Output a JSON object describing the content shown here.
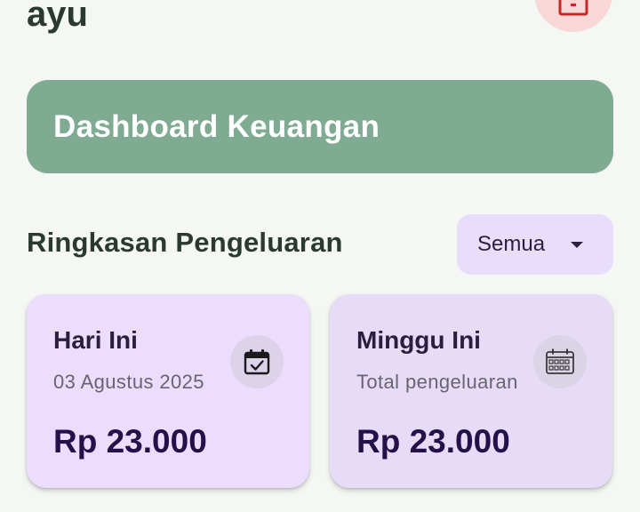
{
  "header": {
    "greeting": "ayu"
  },
  "banner": {
    "title": "Dashboard Keuangan"
  },
  "summary": {
    "title": "Ringkasan Pengeluaran",
    "filter": {
      "selected": "Semua"
    },
    "cards": [
      {
        "title": "Hari Ini",
        "subtitle": "03 Agustus 2025",
        "amount": "Rp 23.000",
        "icon": "calendar-check-icon"
      },
      {
        "title": "Minggu Ini",
        "subtitle": "Total pengeluaran",
        "amount": "Rp 23.000",
        "icon": "calendar-week-icon"
      }
    ]
  },
  "colors": {
    "background": "#f4f7f3",
    "banner": "#7eab91",
    "card_today": "#ecdcfd",
    "card_week": "#e7dcf7",
    "filter": "#e9ddfd",
    "avatar_bg": "#f8d8d6",
    "avatar_icon": "#c62828"
  }
}
